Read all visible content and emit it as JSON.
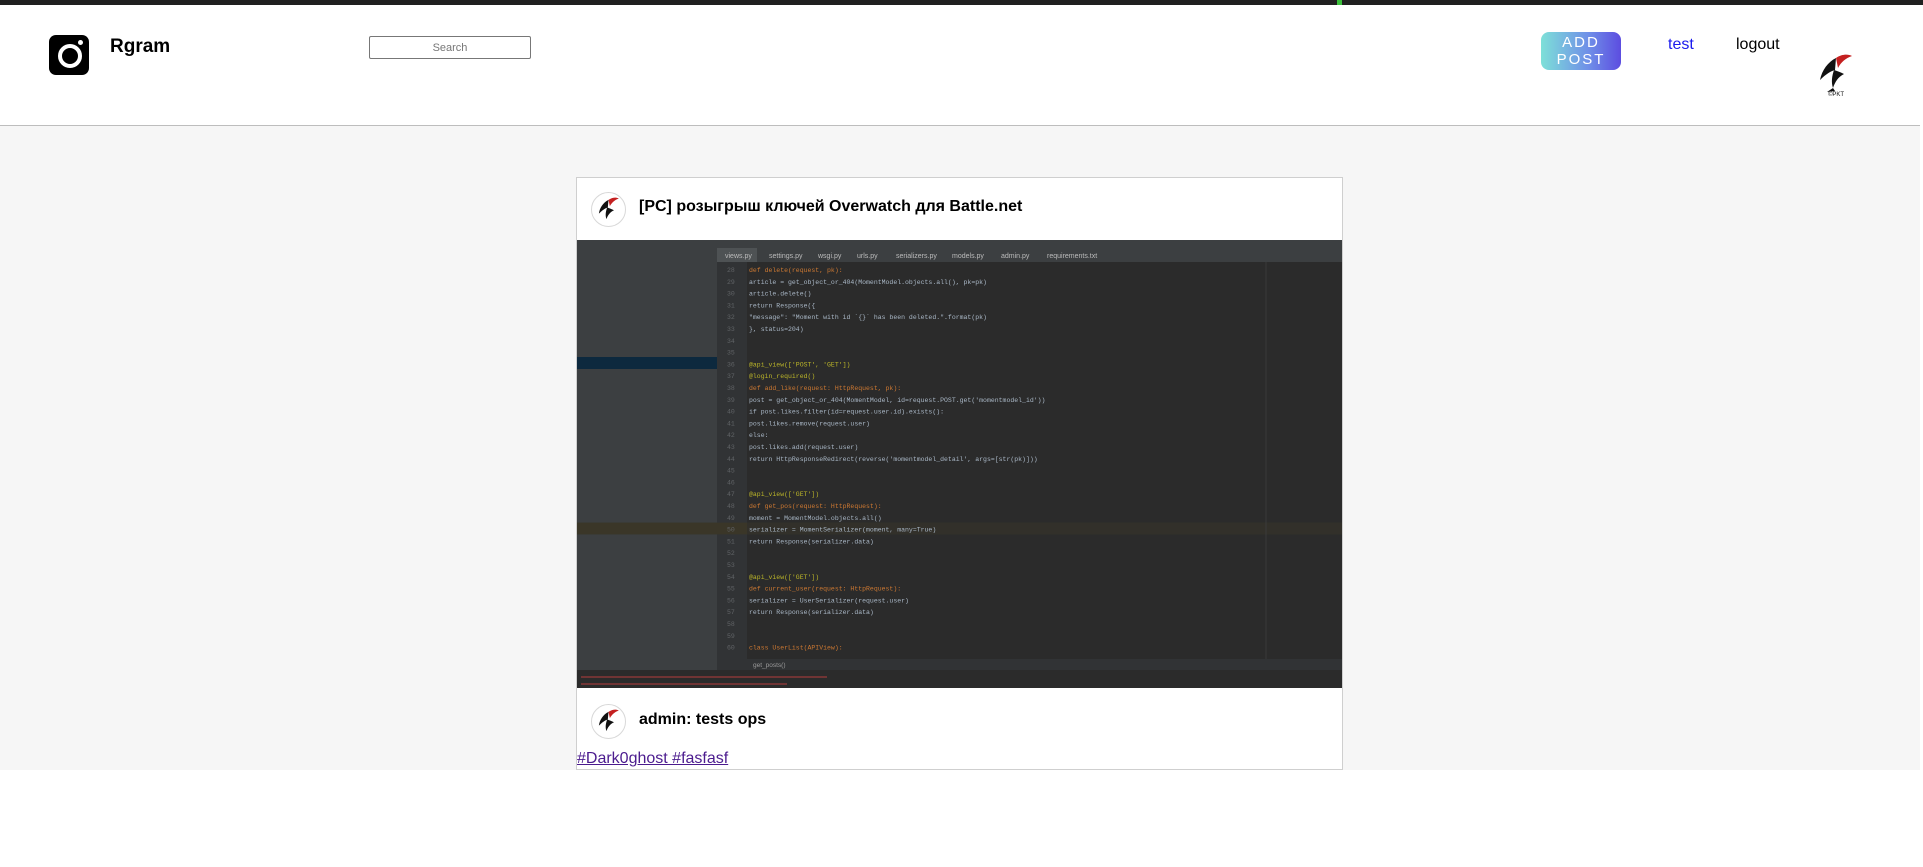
{
  "header": {
    "brand": "Rgram",
    "search_placeholder": "Search",
    "add_post_label": "ADD POST",
    "nav_test": "test",
    "nav_logout": "logout",
    "avatar_caption": "©PKT"
  },
  "post": {
    "title": "[PC] розыгрыш ключей Overwatch для Battle.net",
    "comment": "admin: tests ops",
    "tags_text": "#Dark0ghost #fasfasf"
  },
  "code_screenshot": {
    "tabs": [
      "views.py",
      "settings.py",
      "wsgi.py",
      "urls.py",
      "serializers.py",
      "models.py",
      "admin.py",
      "requirements.txt"
    ],
    "line_numbers": [
      "28",
      "29",
      "30",
      "31",
      "32",
      "33",
      "34",
      "35",
      "36",
      "37",
      "38",
      "39",
      "40",
      "41",
      "42",
      "43",
      "44",
      "45",
      "46",
      "47",
      "48",
      "49",
      "50",
      "51",
      "52",
      "53",
      "54",
      "55",
      "56",
      "57",
      "58",
      "59",
      "60"
    ],
    "lines": [
      "def delete(request, pk):",
      "    article = get_object_or_404(MomentModel.objects.all(), pk=pk)",
      "    article.delete()",
      "    return Response({",
      "        \"message\": \"Moment with id `{}` has been deleted.\".format(pk)",
      "    }, status=204)",
      "",
      "",
      "@api_view(['POST', 'GET'])",
      "@login_required()",
      "def add_like(request: HttpRequest, pk):",
      "    post = get_object_or_404(MomentModel, id=request.POST.get('momentmodel_id'))",
      "    if post.likes.filter(id=request.user.id).exists():",
      "        post.likes.remove(request.user)",
      "    else:",
      "        post.likes.add(request.user)",
      "    return HttpResponseRedirect(reverse('momentmodel_detail', args=[str(pk)]))",
      "",
      "",
      "@api_view(['GET'])",
      "def get_pos(request: HttpRequest):",
      "    moment = MomentModel.objects.all()",
      "    serializer = MomentSerializer(moment, many=True)",
      "    return Response(serializer.data)",
      "",
      "",
      "@api_view(['GET'])",
      "def current_user(request: HttpRequest):",
      "    serializer = UserSerializer(request.user)",
      "    return Response(serializer.data)",
      "",
      "",
      "class UserList(APIView):"
    ],
    "breadcrumb": "get_posts()"
  },
  "colors": {
    "brand_link": "#1a1aee",
    "tag_link": "#4b1b8e",
    "button_gradient_start": "#7de0d8",
    "button_gradient_end": "#5c4de0"
  },
  "icons": {
    "logo": "instagram-camera-icon",
    "avatar": "bird-logo-icon"
  }
}
